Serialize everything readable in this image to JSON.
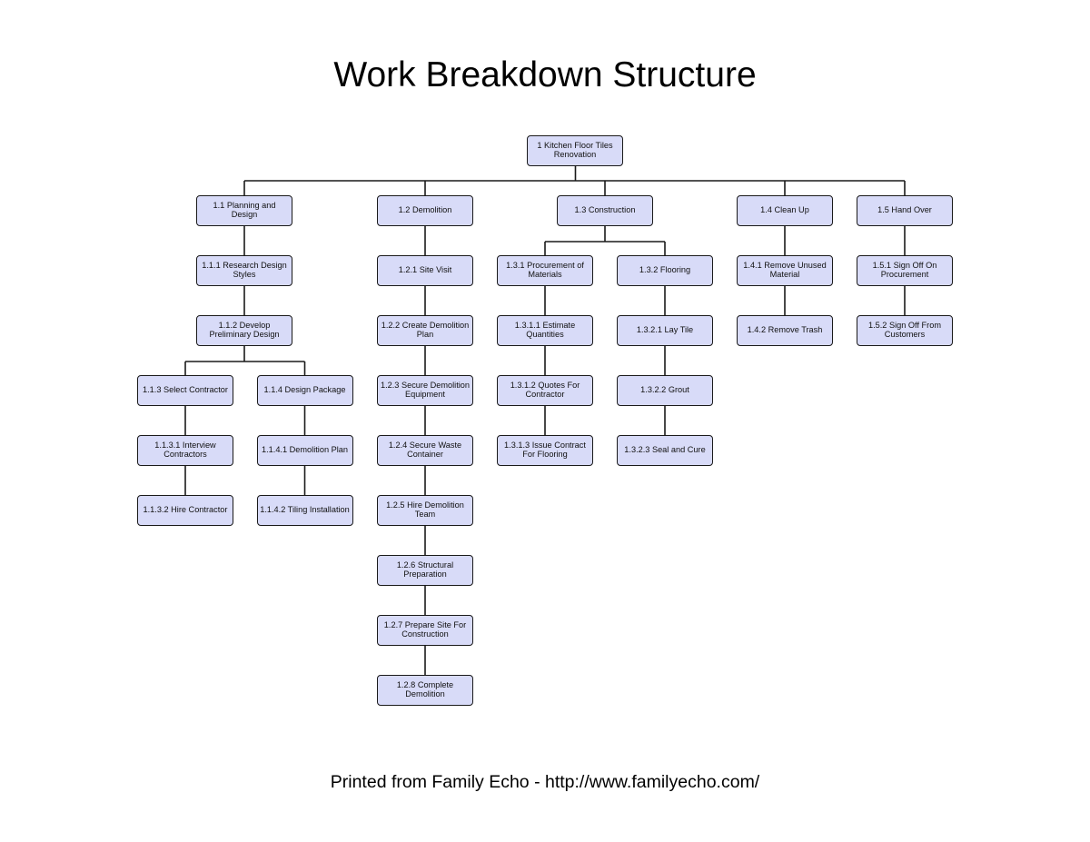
{
  "page": {
    "title": "Work Breakdown Structure",
    "footer": "Printed from Family Echo - http://www.familyecho.com/"
  },
  "colors": {
    "node_fill": "#d8dbf8",
    "node_border": "#1a1a1a",
    "connector": "#1a1a1a",
    "text": "#000000"
  },
  "wbs": {
    "nodes": [
      {
        "code": "1",
        "parent": null,
        "label": "1 Kitchen Floor Tiles\nRenovation"
      },
      {
        "code": "1.1",
        "parent": "1",
        "label": "1.1 Planning and\nDesign"
      },
      {
        "code": "1.1.1",
        "parent": "1.1",
        "label": "1.1.1 Research Design\nStyles"
      },
      {
        "code": "1.1.2",
        "parent": "1.1.1",
        "label": "1.1.2 Develop\nPreliminary Design"
      },
      {
        "code": "1.1.3",
        "parent": "1.1.2",
        "label": "1.1.3 Select Contractor"
      },
      {
        "code": "1.1.3.1",
        "parent": "1.1.3",
        "label": "1.1.3.1 Interview\nContractors"
      },
      {
        "code": "1.1.3.2",
        "parent": "1.1.3.1",
        "label": "1.1.3.2 Hire Contractor"
      },
      {
        "code": "1.1.4",
        "parent": "1.1.2",
        "label": "1.1.4 Design Package"
      },
      {
        "code": "1.1.4.1",
        "parent": "1.1.4",
        "label": "1.1.4.1 Demolition Plan"
      },
      {
        "code": "1.1.4.2",
        "parent": "1.1.4.1",
        "label": "1.1.4.2 Tiling Installation"
      },
      {
        "code": "1.2",
        "parent": "1",
        "label": "1.2 Demolition"
      },
      {
        "code": "1.2.1",
        "parent": "1.2",
        "label": "1.2.1 Site Visit"
      },
      {
        "code": "1.2.2",
        "parent": "1.2.1",
        "label": "1.2.2 Create Demolition\nPlan"
      },
      {
        "code": "1.2.3",
        "parent": "1.2.2",
        "label": "1.2.3 Secure Demolition\nEquipment"
      },
      {
        "code": "1.2.4",
        "parent": "1.2.3",
        "label": "1.2.4 Secure Waste\nContainer"
      },
      {
        "code": "1.2.5",
        "parent": "1.2.4",
        "label": "1.2.5 Hire Demolition\nTeam"
      },
      {
        "code": "1.2.6",
        "parent": "1.2.5",
        "label": "1.2.6 Structural\nPreparation"
      },
      {
        "code": "1.2.7",
        "parent": "1.2.6",
        "label": "1.2.7 Prepare Site For\nConstruction"
      },
      {
        "code": "1.2.8",
        "parent": "1.2.7",
        "label": "1.2.8 Complete\nDemolition"
      },
      {
        "code": "1.3",
        "parent": "1",
        "label": "1.3 Construction"
      },
      {
        "code": "1.3.1",
        "parent": "1.3",
        "label": "1.3.1 Procurement of\nMaterials"
      },
      {
        "code": "1.3.1.1",
        "parent": "1.3.1",
        "label": "1.3.1.1 Estimate\nQuantities"
      },
      {
        "code": "1.3.1.2",
        "parent": "1.3.1.1",
        "label": "1.3.1.2 Quotes For\nContractor"
      },
      {
        "code": "1.3.1.3",
        "parent": "1.3.1.2",
        "label": "1.3.1.3 Issue Contract\nFor Flooring"
      },
      {
        "code": "1.3.2",
        "parent": "1.3",
        "label": "1.3.2 Flooring"
      },
      {
        "code": "1.3.2.1",
        "parent": "1.3.2",
        "label": "1.3.2.1 Lay Tile"
      },
      {
        "code": "1.3.2.2",
        "parent": "1.3.2.1",
        "label": "1.3.2.2 Grout"
      },
      {
        "code": "1.3.2.3",
        "parent": "1.3.2.2",
        "label": "1.3.2.3 Seal and Cure"
      },
      {
        "code": "1.4",
        "parent": "1",
        "label": "1.4 Clean Up"
      },
      {
        "code": "1.4.1",
        "parent": "1.4",
        "label": "1.4.1 Remove Unused\nMaterial"
      },
      {
        "code": "1.4.2",
        "parent": "1.4.1",
        "label": "1.4.2 Remove Trash"
      },
      {
        "code": "1.5",
        "parent": "1",
        "label": "1.5 Hand Over"
      },
      {
        "code": "1.5.1",
        "parent": "1.5",
        "label": "1.5.1 Sign Off On\nProcurement"
      },
      {
        "code": "1.5.2",
        "parent": "1.5.1",
        "label": "1.5.2 Sign Off From\nCustomers"
      }
    ]
  }
}
